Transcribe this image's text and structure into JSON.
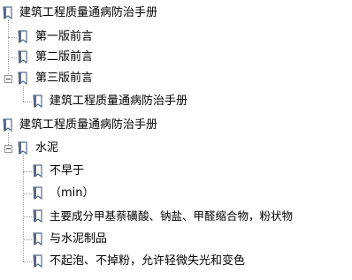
{
  "tree": {
    "nodes": [
      {
        "label": "建筑工程质量通病防治手册",
        "icon": "book-icon"
      },
      {
        "label": "第一版前言",
        "icon": "book-icon"
      },
      {
        "label": "第二版前言",
        "icon": "book-icon"
      },
      {
        "label": "第三版前言",
        "icon": "book-icon",
        "expanded": true
      },
      {
        "label": "建筑工程质量通病防治手册",
        "icon": "book-icon"
      },
      {
        "label": "建筑工程质量通病防治手册",
        "icon": "book-icon"
      },
      {
        "label": "水泥",
        "icon": "book-icon",
        "expanded": true
      },
      {
        "label": "不早于",
        "icon": "book-icon"
      },
      {
        "label": "（min）",
        "icon": "book-icon"
      },
      {
        "label": "主要成分甲基萘磺酸、钠盐、甲醛缩合物，粉状物",
        "icon": "book-icon"
      },
      {
        "label": "与水泥制品",
        "icon": "book-icon"
      },
      {
        "label": "不起泡、不掉粉，允许轻微失光和变色",
        "icon": "book-icon"
      }
    ]
  },
  "colors": {
    "text": "#000000",
    "book_spine": "#5b6b86",
    "book_page": "#ffffff",
    "tree_line": "#a0a0a0"
  }
}
